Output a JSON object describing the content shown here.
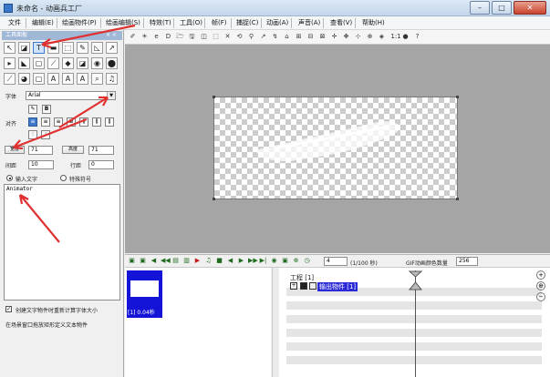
{
  "window": {
    "title": "未命名 - 动画兵工厂",
    "minimize": "–",
    "maximize": "□",
    "close": "✕"
  },
  "menu": [
    {
      "label": "文件"
    },
    {
      "label": "编辑(E)"
    },
    {
      "label": "绘画物件(P)"
    },
    {
      "label": "绘画编辑(S)"
    },
    {
      "label": "特效(T)"
    },
    {
      "label": "工具(O)"
    },
    {
      "label": "帧(F)"
    },
    {
      "label": "捕捉(C)"
    },
    {
      "label": "动画(A)"
    },
    {
      "label": "声音(A)"
    },
    {
      "label": "查看(V)"
    },
    {
      "label": "帮助(H)"
    }
  ],
  "tool_panel": {
    "title": "工具面板",
    "close": "× ×",
    "tools_row1": [
      "↖",
      "◪",
      "T",
      "▬",
      "⬚",
      "✎",
      "◺",
      "↗"
    ],
    "tools_row2": [
      "▸",
      "◣",
      "▢",
      "⟋",
      "◆",
      "◪",
      "◉",
      "⬤"
    ],
    "tools_row3": [
      "⟋",
      "◕",
      "▢",
      "A",
      "A",
      "A",
      "⌕",
      "♫"
    ],
    "font_label": "字体",
    "font_value": "Arial",
    "align_label": "对齐",
    "style_buttons": [
      "✎",
      "B"
    ],
    "width_label": "宽度",
    "width_value": "71",
    "height_label": "高度",
    "height_value": "71",
    "spacing_label": "间距",
    "spacing_value": "10",
    "line_label": "行距",
    "line_value": "0",
    "input_text_label": "输入文字",
    "special_symbol_label": "特殊符号",
    "text_content": "Animator",
    "auto_size_label": "创建文字物件时重新计算字体大小",
    "hint_text": "在场景窗口拖放矩形定义文本物件"
  },
  "main_toolbar": {
    "icons": [
      "✐",
      "☀",
      "e",
      "D",
      "🗁",
      "🖫",
      "◫",
      "⬚",
      "✕",
      "⟲",
      "⚲",
      "↗",
      "↯",
      "⌂",
      "⊞",
      "⊟",
      "⊠",
      "✛",
      "✥",
      "⊹",
      "⊕",
      "◈",
      "1:1",
      "●",
      "?"
    ],
    "zoom_label": "1:1"
  },
  "timeline": {
    "frame_label": "[1] 0.04秒",
    "frame_count": "4",
    "unit": "(1/100 秒)",
    "gif_colors_label": "GIF动画颜色数量",
    "gif_colors_value": "256",
    "project_label": "工程 [1]",
    "object_label": "输出物件 [1]",
    "buttons": [
      "▣",
      "▣",
      "◀",
      "◀◀",
      "▤",
      "▥",
      "▶",
      "♫",
      "■",
      "◀",
      "▶",
      "▶▶",
      "▶|",
      "◉",
      "▣",
      "⊕",
      "◷"
    ]
  }
}
